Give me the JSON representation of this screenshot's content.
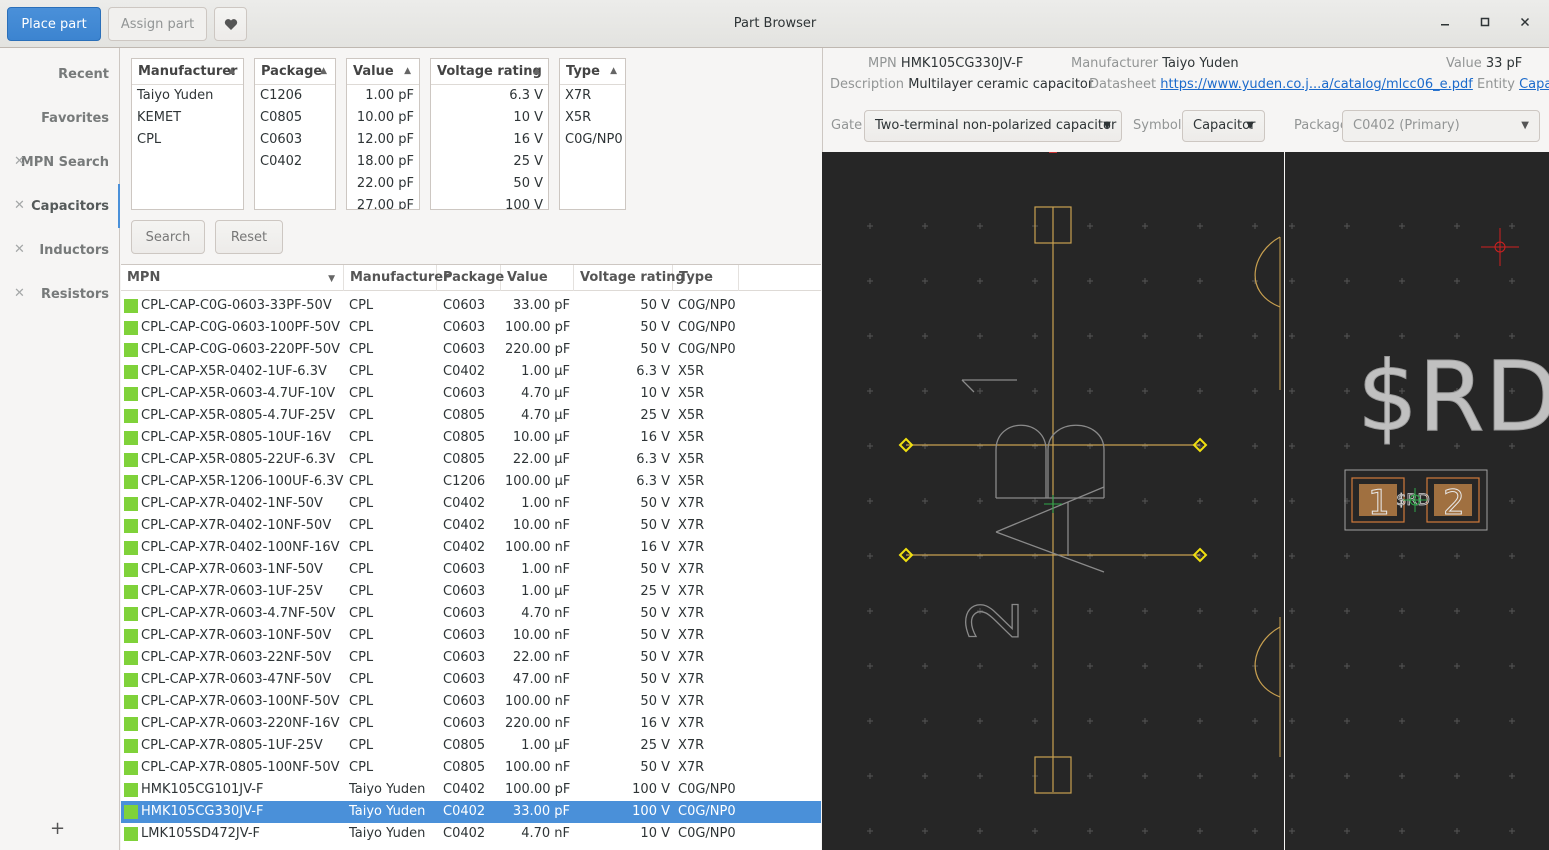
{
  "header": {
    "place_part": "Place part",
    "assign_part": "Assign part",
    "favorite_icon": "heart-icon",
    "title": "Part Browser",
    "minimize": "▁",
    "maximize": "◻",
    "close": "✕"
  },
  "sidebar": {
    "items": [
      {
        "label": "Recent",
        "closable": false
      },
      {
        "label": "Favorites",
        "closable": false
      },
      {
        "label": "MPN Search",
        "closable": true
      },
      {
        "label": "Capacitors",
        "closable": true
      },
      {
        "label": "Inductors",
        "closable": true
      },
      {
        "label": "Resistors",
        "closable": true
      }
    ],
    "close_glyph": "✕",
    "add_glyph": "+"
  },
  "filters": {
    "manufacturer": {
      "header": "Manufacturer",
      "items": [
        "Taiyo Yuden",
        "KEMET",
        "CPL"
      ]
    },
    "package": {
      "header": "Package",
      "items": [
        "C1206",
        "C0805",
        "C0603",
        "C0402"
      ]
    },
    "value": {
      "header": "Value",
      "items": [
        "1.00 pF",
        "10.00 pF",
        "12.00 pF",
        "18.00 pF",
        "22.00 pF",
        "27.00 pF"
      ]
    },
    "voltage": {
      "header": "Voltage rating",
      "items": [
        "6.3 V",
        "10 V",
        "16 V",
        "25 V",
        "50 V",
        "100 V"
      ]
    },
    "type": {
      "header": "Type",
      "items": [
        "X7R",
        "X5R",
        "C0G/NP0"
      ]
    },
    "search": "Search",
    "reset": "Reset"
  },
  "table": {
    "headers": [
      "MPN",
      "Manufacturer",
      "Package",
      "Value",
      "Voltage rating",
      "Type"
    ],
    "selected_index": 23,
    "rows": [
      [
        "CPL-CAP-C0G-0603-33PF-50V",
        "CPL",
        "C0603",
        "33.00 pF",
        "50 V",
        "C0G/NP0"
      ],
      [
        "CPL-CAP-C0G-0603-100PF-50V",
        "CPL",
        "C0603",
        "100.00 pF",
        "50 V",
        "C0G/NP0"
      ],
      [
        "CPL-CAP-C0G-0603-220PF-50V",
        "CPL",
        "C0603",
        "220.00 pF",
        "50 V",
        "C0G/NP0"
      ],
      [
        "CPL-CAP-X5R-0402-1UF-6.3V",
        "CPL",
        "C0402",
        "1.00 µF",
        "6.3 V",
        "X5R"
      ],
      [
        "CPL-CAP-X5R-0603-4.7UF-10V",
        "CPL",
        "C0603",
        "4.70 µF",
        "10 V",
        "X5R"
      ],
      [
        "CPL-CAP-X5R-0805-4.7UF-25V",
        "CPL",
        "C0805",
        "4.70 µF",
        "25 V",
        "X5R"
      ],
      [
        "CPL-CAP-X5R-0805-10UF-16V",
        "CPL",
        "C0805",
        "10.00 µF",
        "16 V",
        "X5R"
      ],
      [
        "CPL-CAP-X5R-0805-22UF-6.3V",
        "CPL",
        "C0805",
        "22.00 µF",
        "6.3 V",
        "X5R"
      ],
      [
        "CPL-CAP-X5R-1206-100UF-6.3V",
        "CPL",
        "C1206",
        "100.00 µF",
        "6.3 V",
        "X5R"
      ],
      [
        "CPL-CAP-X7R-0402-1NF-50V",
        "CPL",
        "C0402",
        "1.00 nF",
        "50 V",
        "X7R"
      ],
      [
        "CPL-CAP-X7R-0402-10NF-50V",
        "CPL",
        "C0402",
        "10.00 nF",
        "50 V",
        "X7R"
      ],
      [
        "CPL-CAP-X7R-0402-100NF-16V",
        "CPL",
        "C0402",
        "100.00 nF",
        "16 V",
        "X7R"
      ],
      [
        "CPL-CAP-X7R-0603-1NF-50V",
        "CPL",
        "C0603",
        "1.00 nF",
        "50 V",
        "X7R"
      ],
      [
        "CPL-CAP-X7R-0603-1UF-25V",
        "CPL",
        "C0603",
        "1.00 µF",
        "25 V",
        "X7R"
      ],
      [
        "CPL-CAP-X7R-0603-4.7NF-50V",
        "CPL",
        "C0603",
        "4.70 nF",
        "50 V",
        "X7R"
      ],
      [
        "CPL-CAP-X7R-0603-10NF-50V",
        "CPL",
        "C0603",
        "10.00 nF",
        "50 V",
        "X7R"
      ],
      [
        "CPL-CAP-X7R-0603-22NF-50V",
        "CPL",
        "C0603",
        "22.00 nF",
        "50 V",
        "X7R"
      ],
      [
        "CPL-CAP-X7R-0603-47NF-50V",
        "CPL",
        "C0603",
        "47.00 nF",
        "50 V",
        "X7R"
      ],
      [
        "CPL-CAP-X7R-0603-100NF-50V",
        "CPL",
        "C0603",
        "100.00 nF",
        "50 V",
        "X7R"
      ],
      [
        "CPL-CAP-X7R-0603-220NF-16V",
        "CPL",
        "C0603",
        "220.00 nF",
        "16 V",
        "X7R"
      ],
      [
        "CPL-CAP-X7R-0805-1UF-25V",
        "CPL",
        "C0805",
        "1.00 µF",
        "25 V",
        "X7R"
      ],
      [
        "CPL-CAP-X7R-0805-100NF-50V",
        "CPL",
        "C0805",
        "100.00 nF",
        "50 V",
        "X7R"
      ],
      [
        "HMK105CG101JV-F",
        "Taiyo Yuden",
        "C0402",
        "100.00 pF",
        "100 V",
        "C0G/NP0"
      ],
      [
        "HMK105CG330JV-F",
        "Taiyo Yuden",
        "C0402",
        "33.00 pF",
        "100 V",
        "C0G/NP0"
      ],
      [
        "LMK105SD472JV-F",
        "Taiyo Yuden",
        "C0402",
        "4.70 nF",
        "10 V",
        "C0G/NP0"
      ]
    ],
    "row_color": "#7fd23a",
    "selection_color": "#4a90d9"
  },
  "details": {
    "mpn_label": "MPN",
    "mpn": "HMK105CG330JV-F",
    "manufacturer_label": "Manufacturer",
    "manufacturer": "Taiyo Yuden",
    "value_label": "Value",
    "value": "33 pF",
    "description_label": "Description",
    "description": "Multilayer ceramic capacitor",
    "datasheet_label": "Datasheet",
    "datasheet": "https://www.yuden.co.j...a/catalog/mlcc06_e.pdf",
    "entity_label": "Entity",
    "entity": "Capacitor",
    "gate_label": "Gate",
    "gate": "Two-terminal non-polarized capacitor",
    "symbol_label": "Symbol",
    "symbol": "Capacitor",
    "package_label": "Package",
    "package": "C0402 (Primary)"
  },
  "preview": {
    "pin1": "1",
    "pin2": "2",
    "refdes": "$RD",
    "pad1": "1",
    "pad2": "2",
    "pad_refdes": "$RD"
  }
}
